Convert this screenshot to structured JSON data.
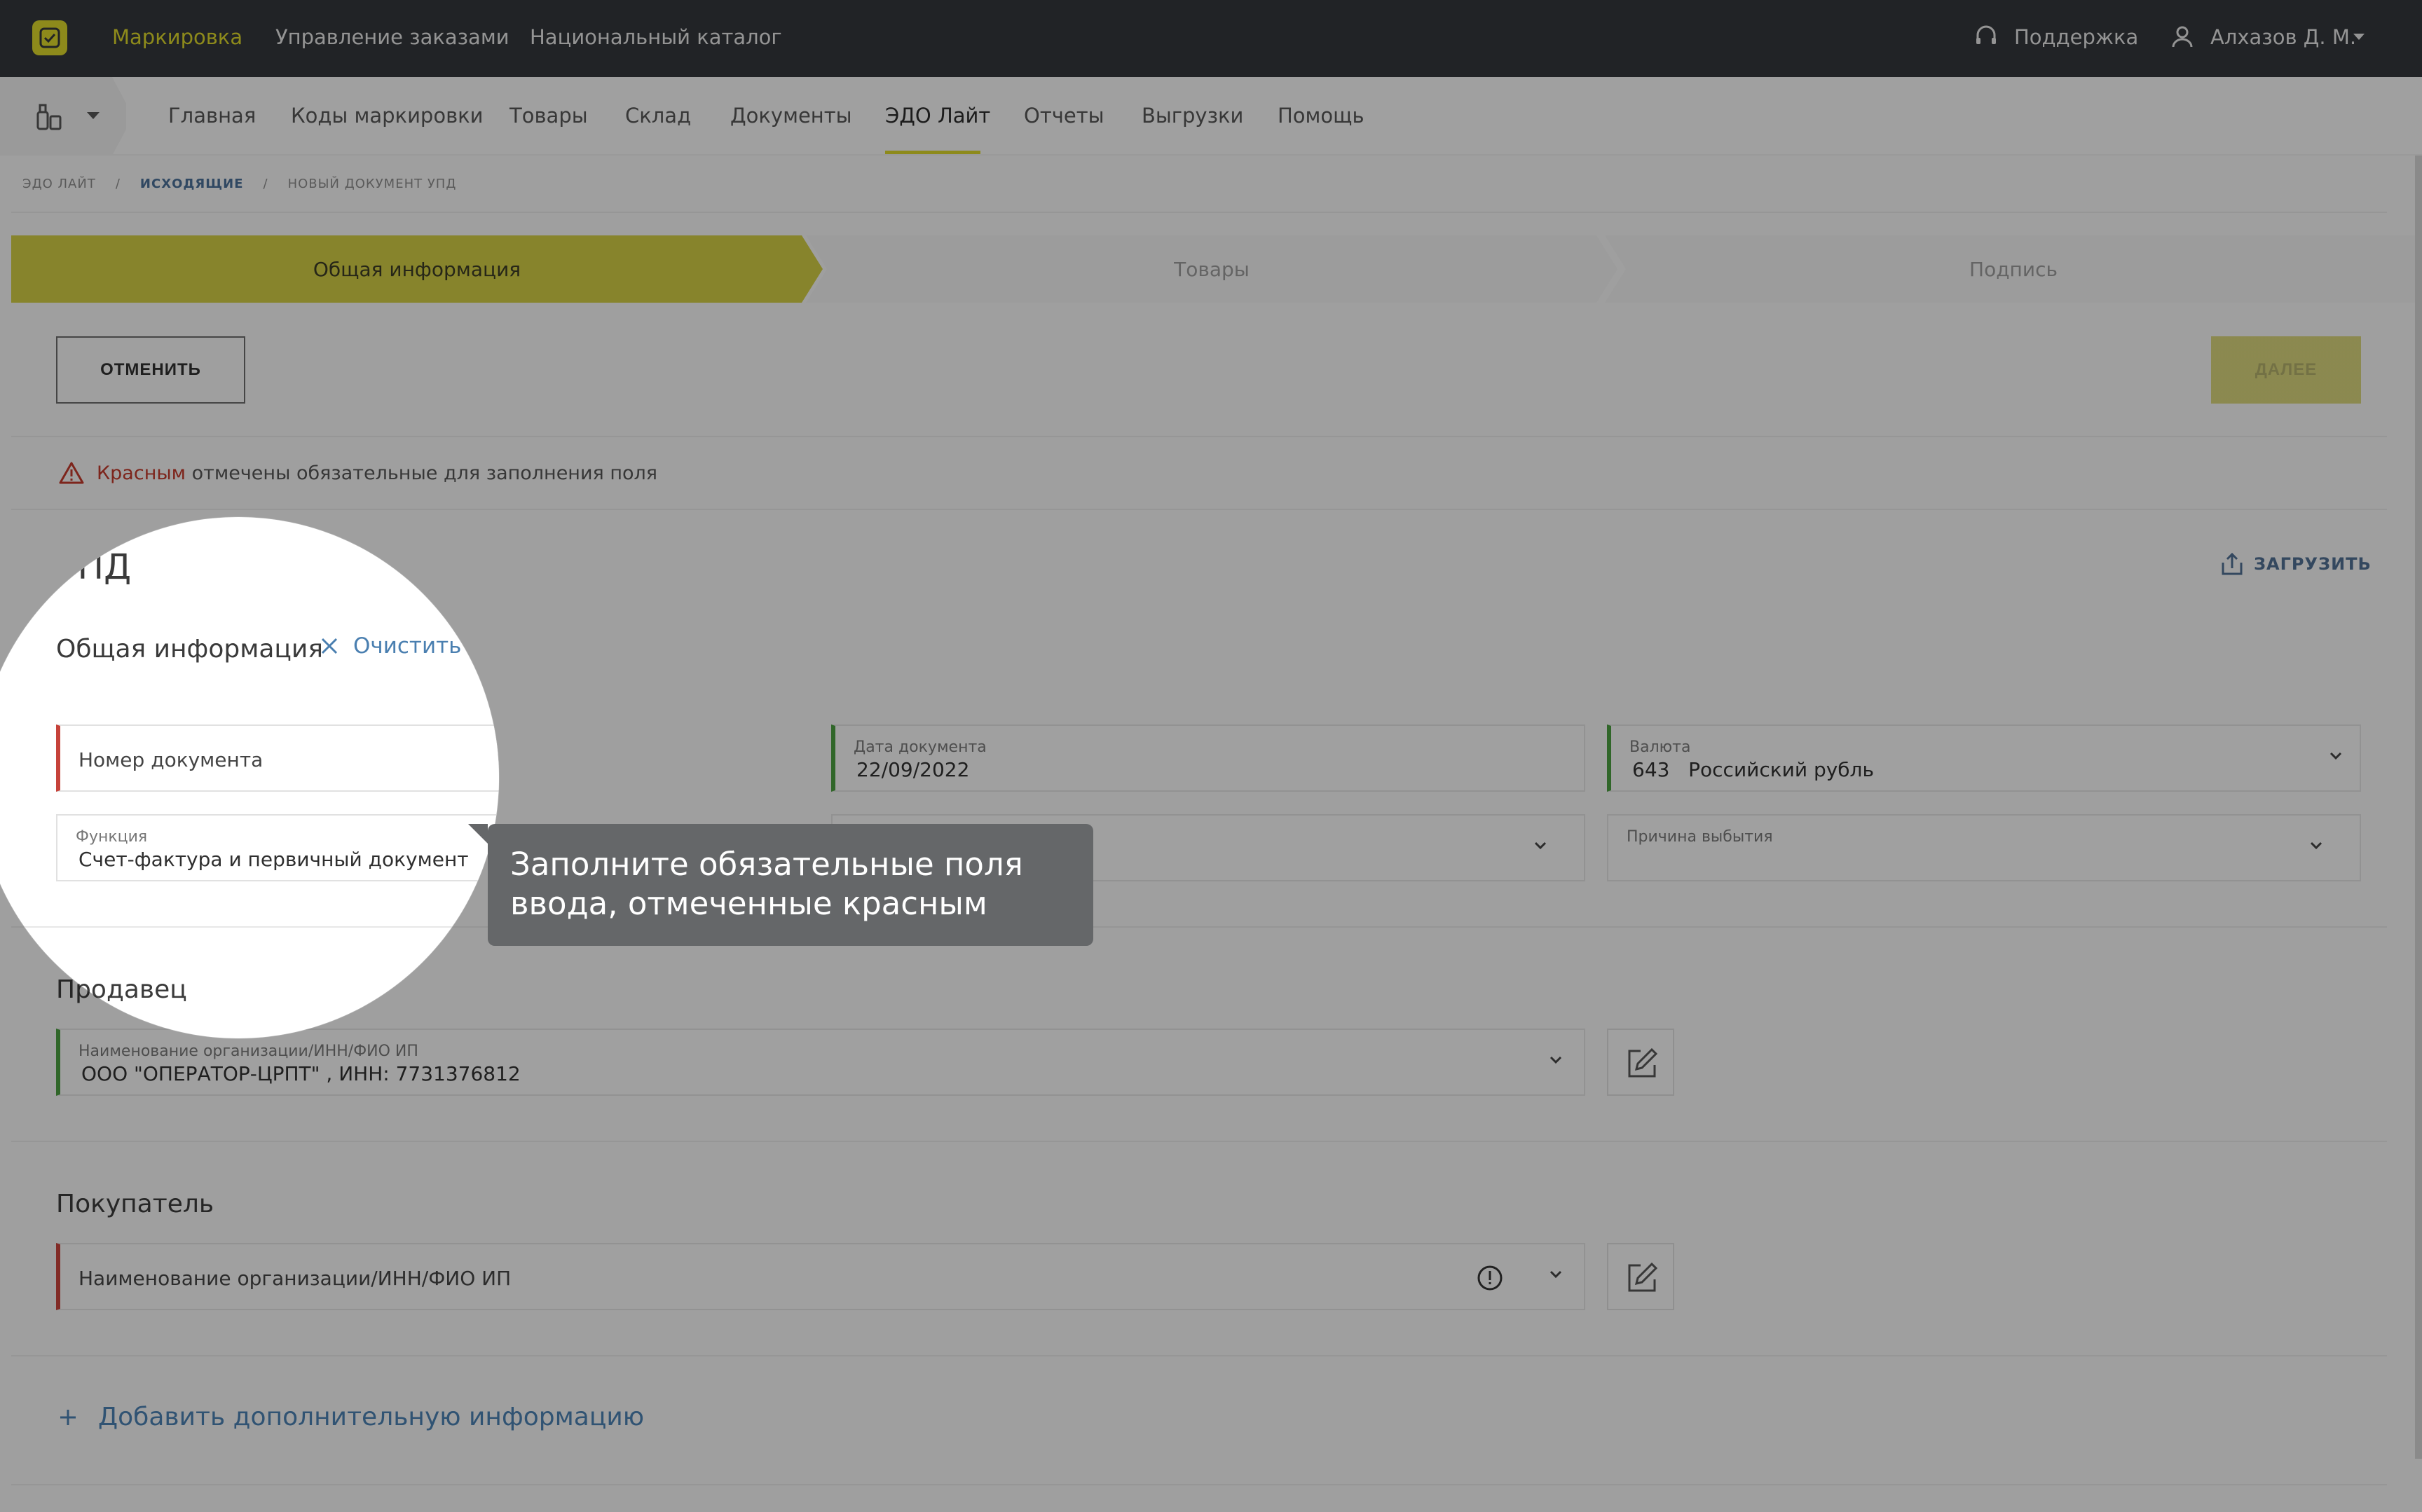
{
  "header": {
    "nav": [
      "Маркировка",
      "Управление заказами",
      "Национальный каталог"
    ],
    "support": "Поддержка",
    "user": "Алхазов Д. М."
  },
  "subnav": {
    "items": [
      "Главная",
      "Коды маркировки",
      "Товары",
      "Склад",
      "Документы",
      "ЭДО Лайт",
      "Отчеты",
      "Выгрузки",
      "Помощь"
    ],
    "active": "ЭДО Лайт"
  },
  "breadcrumbs": [
    "ЭДО Лайт",
    "Исходящие",
    "Новый документ УПД"
  ],
  "steps": [
    "Общая информация",
    "Товары",
    "Подпись"
  ],
  "actions": {
    "cancel": "ОТМЕНИТЬ",
    "next": "ДАЛЕЕ",
    "upload": "ЗАГРУЗИТЬ"
  },
  "warning": {
    "red_word": "Красным",
    "rest": " отмечены обязательные для заполнения поля"
  },
  "title": "УПД",
  "general": {
    "heading": "Общая информация",
    "clear_all": "Очистить все",
    "doc_number_placeholder": "Номер документа",
    "doc_date_label": "Дата документа",
    "doc_date_value": "22/09/2022",
    "currency_label": "Валюта",
    "currency_value": "643   Российский рубль",
    "function_label": "Функция",
    "function_value": "Счет-фактура и первичный документ",
    "reason_label": "Причина выбытия"
  },
  "seller": {
    "heading": "Продавец",
    "label": "Наименование организации/ИНН/ФИО ИП",
    "value": "ООО \"ОПЕРАТОР-ЦРПТ\" , ИНН: 7731376812"
  },
  "buyer": {
    "heading": "Покупатель",
    "placeholder": "Наименование организации/ИНН/ФИО ИП"
  },
  "add_info": "Добавить дополнительную информацию",
  "tooltip": {
    "line1": "Заполните обязательные поля",
    "line2": "ввода, отмеченные красным"
  },
  "colors": {
    "accent": "#d9d42a",
    "required": "#c6423a",
    "filled": "#4a9d3f",
    "link": "#4a7fb0",
    "topbar": "#33363a"
  }
}
